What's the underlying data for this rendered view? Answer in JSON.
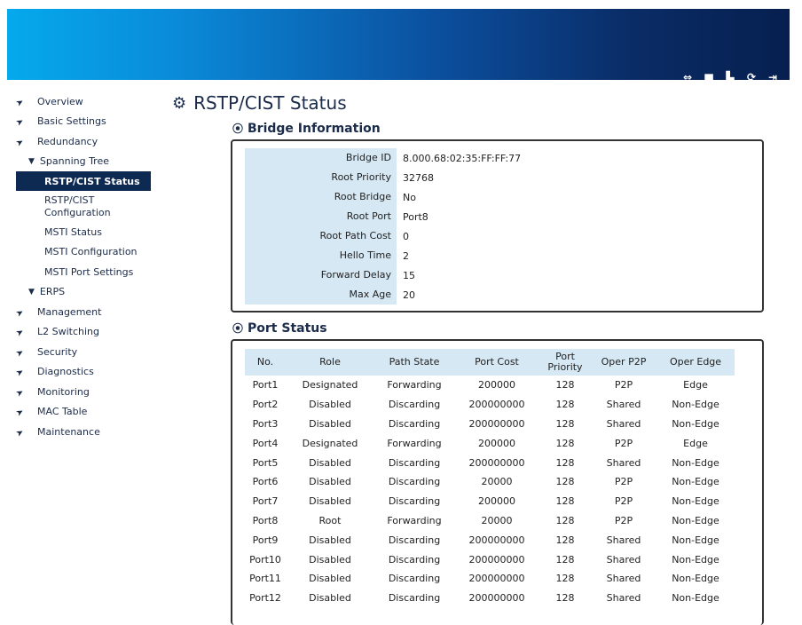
{
  "header": {
    "icons": [
      "link-icon",
      "save-icon",
      "save-clear-icon",
      "refresh-icon",
      "logout-icon"
    ]
  },
  "sidebar": {
    "items": [
      {
        "label": "Overview"
      },
      {
        "label": "Basic Settings"
      },
      {
        "label": "Redundancy"
      },
      {
        "label": "Management"
      },
      {
        "label": "L2 Switching"
      },
      {
        "label": "Security"
      },
      {
        "label": "Diagnostics"
      },
      {
        "label": "Monitoring"
      },
      {
        "label": "MAC Table"
      },
      {
        "label": "Maintenance"
      }
    ],
    "spanning_tree": {
      "label": "Spanning Tree",
      "children": [
        {
          "label": "RSTP/CIST Status"
        },
        {
          "label": "RSTP/CIST\nConfiguration"
        },
        {
          "label": "MSTI Status"
        },
        {
          "label": "MSTI Configuration"
        },
        {
          "label": "MSTI Port Settings"
        }
      ]
    },
    "erps": {
      "label": "ERPS"
    }
  },
  "page": {
    "title": "RSTP/CIST Status"
  },
  "bridge": {
    "title": "Bridge Information",
    "rows": [
      {
        "label": "Bridge ID",
        "value": "8.000.68:02:35:FF:FF:77"
      },
      {
        "label": "Root Priority",
        "value": "32768"
      },
      {
        "label": "Root Bridge",
        "value": "No"
      },
      {
        "label": "Root Port",
        "value": "Port8"
      },
      {
        "label": "Root Path Cost",
        "value": "0"
      },
      {
        "label": "Hello Time",
        "value": "2"
      },
      {
        "label": "Forward Delay",
        "value": "15"
      },
      {
        "label": "Max Age",
        "value": "20"
      }
    ]
  },
  "ports": {
    "title": "Port Status",
    "headers": [
      "No.",
      "Role",
      "Path State",
      "Port Cost",
      "Port Priority",
      "Oper P2P",
      "Oper Edge"
    ],
    "rows": [
      [
        "Port1",
        "Designated",
        "Forwarding",
        "200000",
        "128",
        "P2P",
        "Edge"
      ],
      [
        "Port2",
        "Disabled",
        "Discarding",
        "200000000",
        "128",
        "Shared",
        "Non-Edge"
      ],
      [
        "Port3",
        "Disabled",
        "Discarding",
        "200000000",
        "128",
        "Shared",
        "Non-Edge"
      ],
      [
        "Port4",
        "Designated",
        "Forwarding",
        "200000",
        "128",
        "P2P",
        "Edge"
      ],
      [
        "Port5",
        "Disabled",
        "Discarding",
        "200000000",
        "128",
        "Shared",
        "Non-Edge"
      ],
      [
        "Port6",
        "Disabled",
        "Discarding",
        "20000",
        "128",
        "P2P",
        "Non-Edge"
      ],
      [
        "Port7",
        "Disabled",
        "Discarding",
        "200000",
        "128",
        "P2P",
        "Non-Edge"
      ],
      [
        "Port8",
        "Root",
        "Forwarding",
        "20000",
        "128",
        "P2P",
        "Non-Edge"
      ],
      [
        "Port9",
        "Disabled",
        "Discarding",
        "200000000",
        "128",
        "Shared",
        "Non-Edge"
      ],
      [
        "Port10",
        "Disabled",
        "Discarding",
        "200000000",
        "128",
        "Shared",
        "Non-Edge"
      ],
      [
        "Port11",
        "Disabled",
        "Discarding",
        "200000000",
        "128",
        "Shared",
        "Non-Edge"
      ],
      [
        "Port12",
        "Disabled",
        "Discarding",
        "200000000",
        "128",
        "Shared",
        "Non-Edge"
      ]
    ]
  }
}
